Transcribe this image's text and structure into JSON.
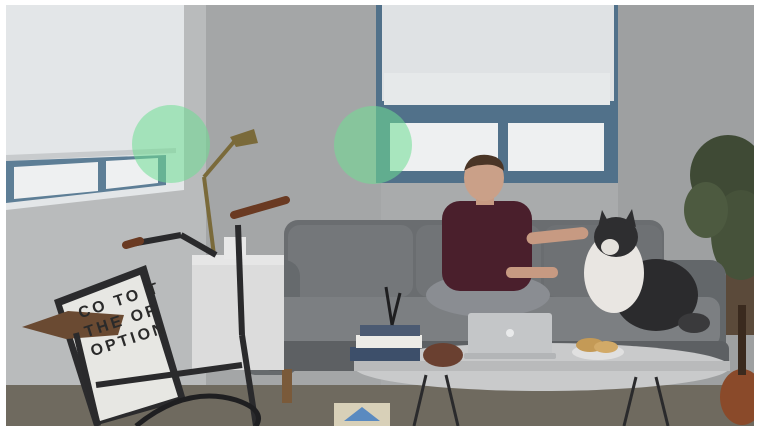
{
  "scene": {
    "poster_lines": [
      "CO TO T",
      "THE OF",
      "OPTION"
    ],
    "laptop_logo": "apple-logo-icon",
    "hotspot_color": "#70de94"
  },
  "hotspots": [
    {
      "name": "lamp-hotspot"
    },
    {
      "name": "window-hotspot"
    }
  ]
}
